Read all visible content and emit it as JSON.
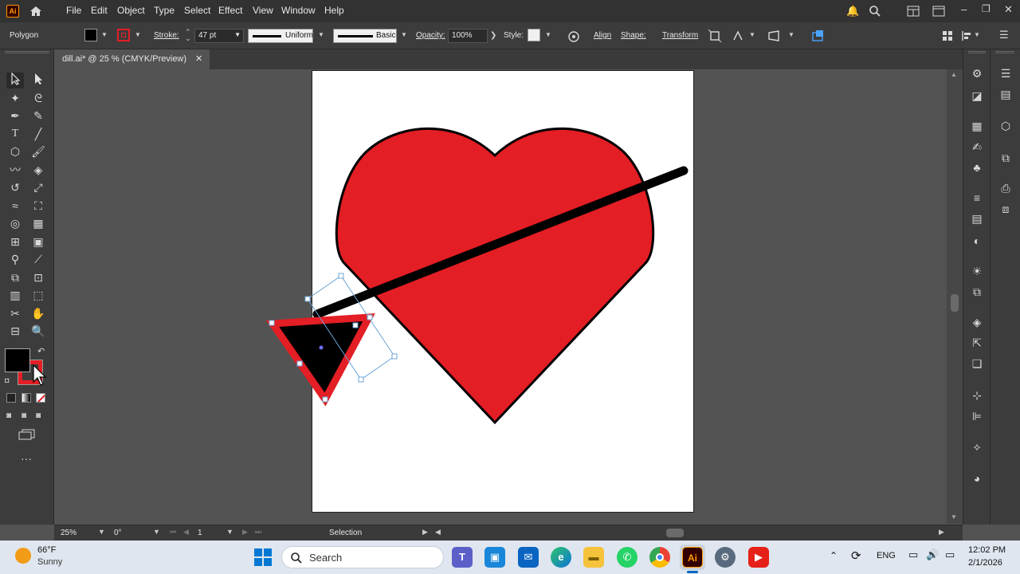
{
  "app": {
    "logo": "Ai"
  },
  "menu": [
    "File",
    "Edit",
    "Object",
    "Type",
    "Select",
    "Effect",
    "View",
    "Window",
    "Help"
  ],
  "control_bar": {
    "object_type": "Polygon",
    "stroke_label": "Stroke:",
    "stroke_value": "47 pt",
    "profile_uniform": "Uniform",
    "brush_basic": "Basic",
    "opacity_label": "Opacity:",
    "opacity_value": "100%",
    "style_label": "Style:",
    "align_label": "Align",
    "shape_label": "Shape:",
    "transform_label": "Transform"
  },
  "document_tab": {
    "title": "dill.ai* @ 25 % (CMYK/Preview)",
    "close": "✕"
  },
  "status_bar": {
    "zoom": "25%",
    "rotation": "0°",
    "artboard": "1",
    "tool": "Selection"
  },
  "colors": {
    "fill": "#000000",
    "stroke": "#e31e24",
    "heart": "#e31e24",
    "accent": "#ff9a00"
  },
  "taskbar": {
    "weather_temp": "66°F",
    "weather_desc": "Sunny",
    "search_placeholder": "Search",
    "lang": "ENG",
    "time": "12:02 PM",
    "date": "2/1/2026",
    "apps": [
      "windows-start",
      "teams",
      "ms-store",
      "outlook",
      "edge",
      "file-explorer",
      "whatsapp",
      "chrome",
      "illustrator",
      "settings",
      "youtube"
    ]
  }
}
